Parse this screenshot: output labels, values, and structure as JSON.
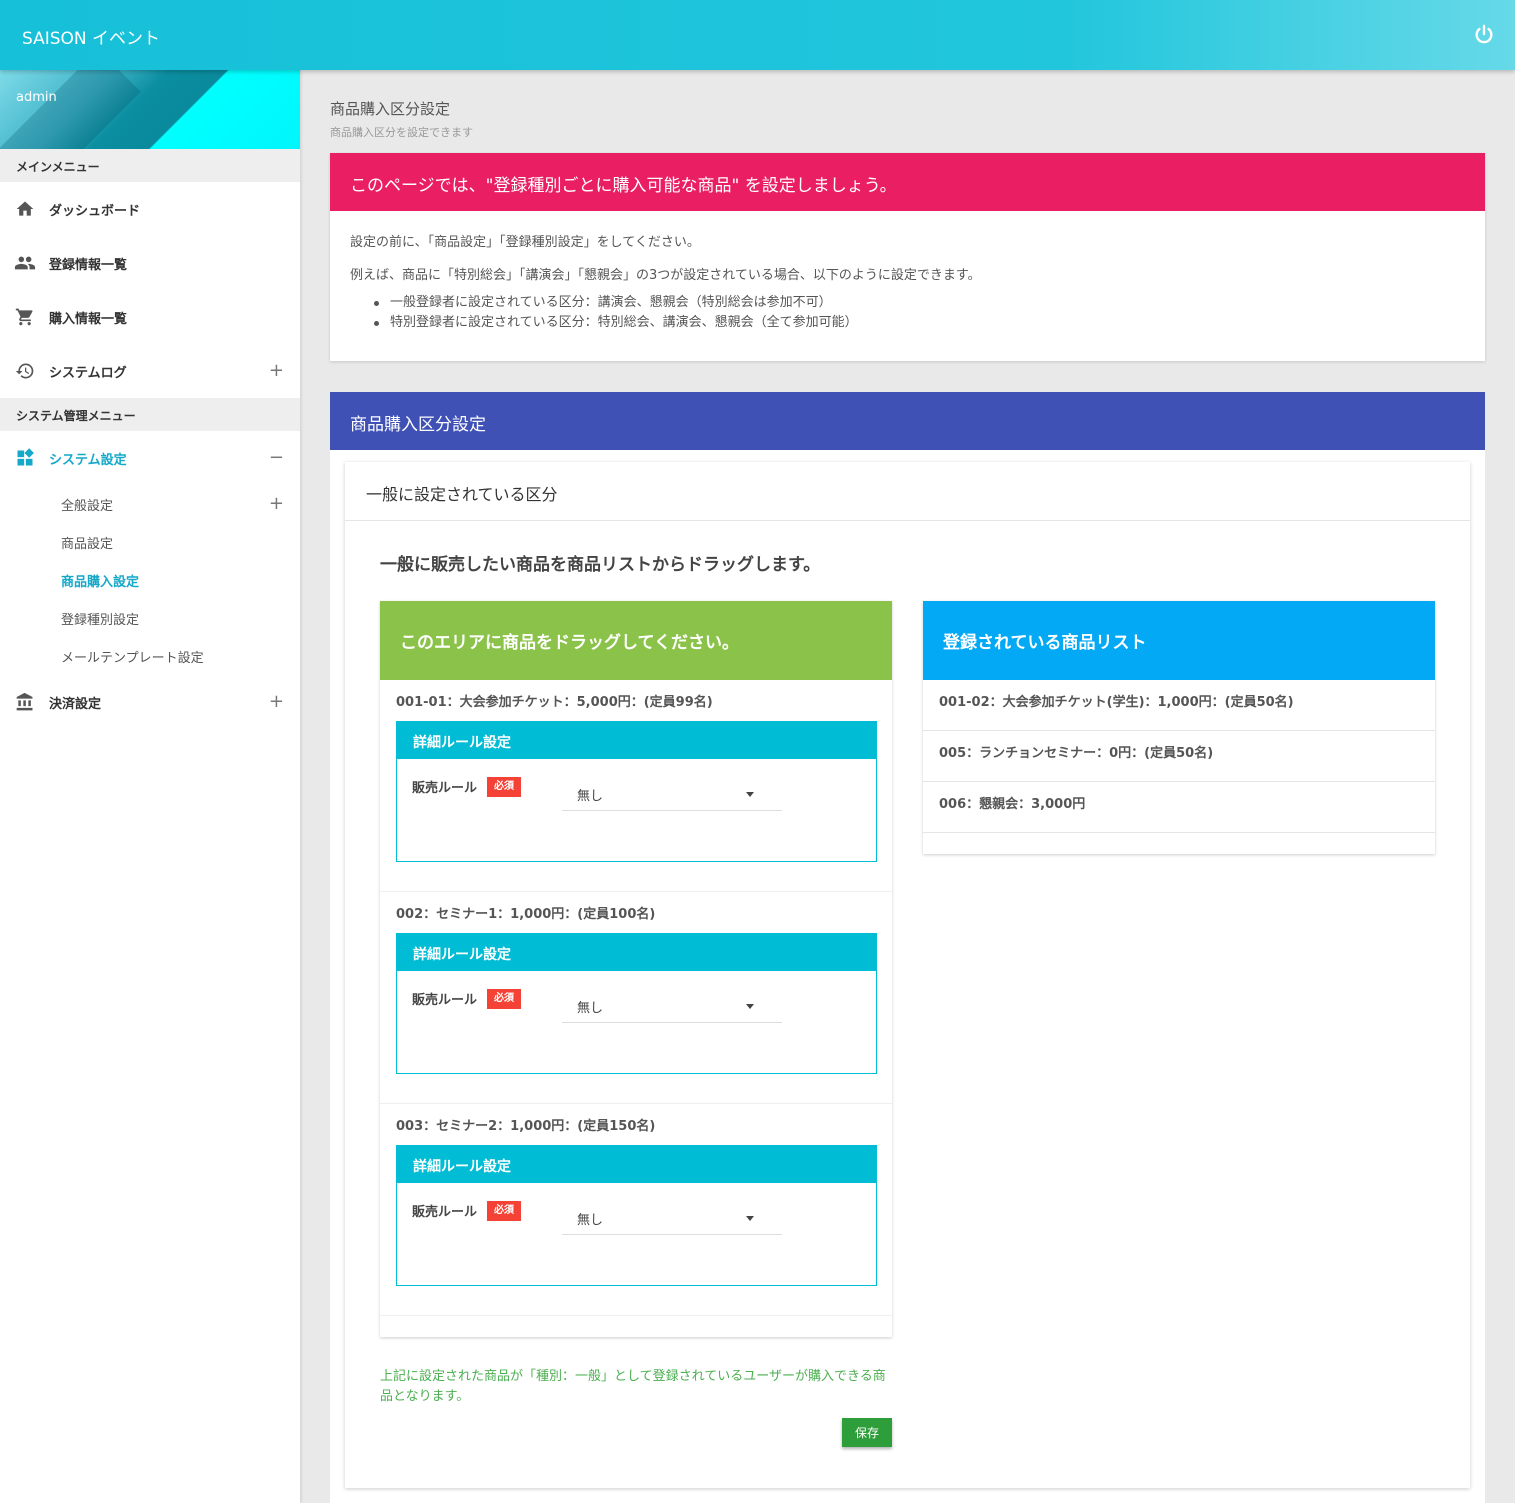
{
  "header": {
    "brand": "SAISON イベント",
    "power_icon": "power-icon"
  },
  "sidebar": {
    "user": "admin",
    "main_menu_label": "メインメニュー",
    "main_items": [
      {
        "label": "ダッシュボード",
        "icon": "home-icon"
      },
      {
        "label": "登録情報一覧",
        "icon": "people-icon"
      },
      {
        "label": "購入情報一覧",
        "icon": "cart-icon"
      },
      {
        "label": "システムログ",
        "icon": "history-icon",
        "toggle": "+"
      }
    ],
    "system_menu_label": "システム管理メニュー",
    "system_settings": {
      "label": "システム設定",
      "icon": "dashboard-icon",
      "toggle": "−"
    },
    "sub_items": [
      {
        "label": "全般設定",
        "toggle": "+"
      },
      {
        "label": "商品設定"
      },
      {
        "label": "商品購入設定"
      },
      {
        "label": "登録種別設定"
      },
      {
        "label": "メールテンプレート設定"
      }
    ],
    "payment": {
      "label": "決済設定",
      "icon": "bank-icon",
      "toggle": "+"
    }
  },
  "page": {
    "title": "商品購入区分設定",
    "subtitle": "商品購入区分を設定できます"
  },
  "info_card": {
    "heading": "このページでは、\"登録種別ごとに購入可能な商品\" を設定しましょう。",
    "line1": "設定の前に、「商品設定」「登録種別設定」をしてください。",
    "line2": "例えば、商品に「特別総会」「講演会」「懇親会」の3つが設定されている場合、以下のように設定できます。",
    "bullets": [
      "一般登録者に設定されている区分：講演会、懇親会（特別総会は参加不可）",
      "特別登録者に設定されている区分：特別総会、講演会、懇親会（全て参加可能）"
    ]
  },
  "settings_card": {
    "heading": "商品購入区分設定",
    "section_title": "一般に設定されている区分",
    "instruction": "一般に販売したい商品を商品リストからドラッグします。",
    "drop_area": {
      "heading": "このエリアに商品をドラッグしてください。",
      "products": [
        {
          "title": "001-01：大会参加チケット：5,000円：(定員99名)",
          "rule_heading": "詳細ルール設定",
          "rule_label": "販売ルール",
          "required": "必須",
          "value": "無し"
        },
        {
          "title": "002：セミナー1：1,000円：(定員100名)",
          "rule_heading": "詳細ルール設定",
          "rule_label": "販売ルール",
          "required": "必須",
          "value": "無し"
        },
        {
          "title": "003：セミナー2：1,000円：(定員150名)",
          "rule_heading": "詳細ルール設定",
          "rule_label": "販売ルール",
          "required": "必須",
          "value": "無し"
        }
      ]
    },
    "product_list": {
      "heading": "登録されている商品リスト",
      "items": [
        "001-02：大会参加チケット(学生)：1,000円：(定員50名)",
        "005：ランチョンセミナー：0円：(定員50名)",
        "006：懇親会：3,000円"
      ]
    },
    "note": "上記に設定された商品が「種別：一般」として登録されているユーザーが購入できる商品となります。",
    "save_label": "保存"
  },
  "colors": {
    "topbar": "#21c6dc",
    "info_head": "#e91e63",
    "settings_head": "#3f51b5",
    "drop_head": "#8bc34a",
    "list_head": "#03a9f4",
    "rule_head": "#00bcd4",
    "required": "#f44336",
    "save": "#2e9e3a"
  }
}
